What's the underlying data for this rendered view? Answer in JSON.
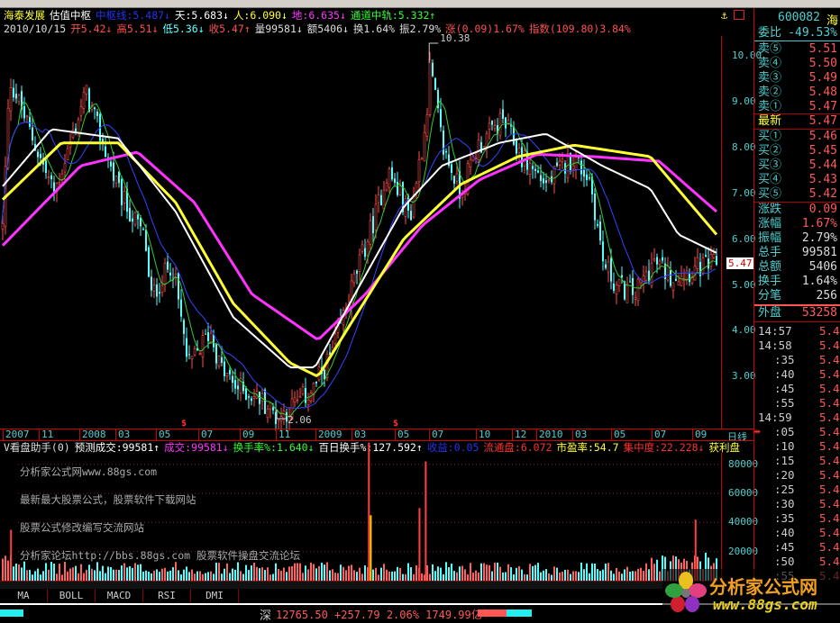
{
  "header": {
    "line1": [
      {
        "text": "海泰发展",
        "color": "#ffff33"
      },
      {
        "text": "估值中枢",
        "color": "#ffffff"
      },
      {
        "text": "中枢线:5.487↓",
        "color": "#2233ee"
      },
      {
        "text": "天:5.683↓",
        "color": "#ffffff"
      },
      {
        "text": "人:6.090↓",
        "color": "#ffff33"
      },
      {
        "text": "地:6.635↓",
        "color": "#ff33ff"
      },
      {
        "text": "通道中轨:5.332↑",
        "color": "#33ff33"
      }
    ],
    "line2": [
      {
        "text": "2010/10/15",
        "color": "#dddddd"
      },
      {
        "text": "开5.42↓",
        "color": "#ff5050"
      },
      {
        "text": "高5.51↓",
        "color": "#ff5050"
      },
      {
        "text": "低5.36↓",
        "color": "#66ffff"
      },
      {
        "text": "收5.47↑",
        "color": "#ff5050"
      },
      {
        "text": "量99581↓",
        "color": "#dddddd"
      },
      {
        "text": "额5406↓",
        "color": "#dddddd"
      },
      {
        "text": "换1.64%",
        "color": "#dddddd"
      },
      {
        "text": "振2.79%",
        "color": "#dddddd"
      },
      {
        "text": "涨(0.09)1.67%",
        "color": "#ff5050"
      },
      {
        "text": "指数(109.80)3.84%",
        "color": "#ff5050"
      }
    ]
  },
  "volume_header": [
    {
      "text": "V看盘助手(0)",
      "color": "#dddddd"
    },
    {
      "text": "预测成交:99581↑",
      "color": "#ffffff"
    },
    {
      "text": "成交:99581↓",
      "color": "#ff33ff"
    },
    {
      "text": "换手率%:1.640↓",
      "color": "#33ff33"
    },
    {
      "text": "百日换手%:127.592↑",
      "color": "#ffffff"
    },
    {
      "text": "收益:0.05",
      "color": "#2233ee"
    },
    {
      "text": "流通盘:6.072",
      "color": "#ff3030"
    },
    {
      "text": "市盈率:54.7",
      "color": "#ffff33"
    },
    {
      "text": "集中度:22.228↓",
      "color": "#ff3030"
    },
    {
      "text": "获利盘",
      "color": "#ffff33"
    }
  ],
  "watermark_lines": [
    "分析家公式网www.88gs.com",
    "最新最大股票公式，股票软件下载网站",
    "股票公式修改编写交流网站",
    "分析家论坛http://bbs.88gs.com 股票软件操盘交流论坛"
  ],
  "logo": {
    "title": "分析家公式网",
    "url": "www.88gs.com"
  },
  "right_panel": {
    "code": "600082",
    "name": "海",
    "weibi_label": "委比",
    "weibi": "-49.53%",
    "sells": [
      {
        "label": "卖⑤",
        "price": "5.51"
      },
      {
        "label": "卖④",
        "price": "5.50"
      },
      {
        "label": "卖③",
        "price": "5.49"
      },
      {
        "label": "卖②",
        "price": "5.48"
      },
      {
        "label": "卖①",
        "price": "5.47"
      }
    ],
    "latest": {
      "label": "最新",
      "price": "5.47"
    },
    "buys": [
      {
        "label": "买①",
        "price": "5.46"
      },
      {
        "label": "买②",
        "price": "5.45"
      },
      {
        "label": "买③",
        "price": "5.44"
      },
      {
        "label": "买④",
        "price": "5.43"
      },
      {
        "label": "买⑤",
        "price": "5.42"
      }
    ],
    "stats": [
      {
        "label": "涨跌",
        "value": "0.09",
        "color": "#ff5a5a"
      },
      {
        "label": "涨幅",
        "value": "1.67%",
        "color": "#ff5a5a"
      },
      {
        "label": "振幅",
        "value": "2.79%",
        "color": "#dddddd"
      },
      {
        "label": "总手",
        "value": "99581",
        "color": "#dddddd"
      },
      {
        "label": "总额",
        "value": "5406",
        "color": "#dddddd"
      },
      {
        "label": "换手",
        "value": "1.64%",
        "color": "#dddddd"
      },
      {
        "label": "分笔",
        "value": "256",
        "color": "#dddddd"
      }
    ],
    "outer": {
      "label": "外盘",
      "value": "53258"
    },
    "ticks": [
      {
        "t": "14:57",
        "p": "5.4"
      },
      {
        "t": "14:58",
        "p": "5.4"
      },
      {
        "t": ":35",
        "p": "5.4"
      },
      {
        "t": ":40",
        "p": "5.4"
      },
      {
        "t": ":45",
        "p": "5.4"
      },
      {
        "t": ":55",
        "p": "5.4"
      },
      {
        "t": "14:59",
        "p": "5.4"
      },
      {
        "t": ":05",
        "p": "5.4"
      },
      {
        "t": ":10",
        "p": "5.4"
      },
      {
        "t": ":15",
        "p": "5.4"
      },
      {
        "t": ":20",
        "p": "5.4"
      },
      {
        "t": ":25",
        "p": "5.4"
      },
      {
        "t": ":30",
        "p": "5.4"
      },
      {
        "t": ":35",
        "p": "5.4"
      },
      {
        "t": ":40",
        "p": "5.4"
      },
      {
        "t": ":45",
        "p": "5.4"
      },
      {
        "t": ":50",
        "p": "5.4"
      },
      {
        "t": ":55",
        "p": "5.4"
      }
    ]
  },
  "price_axis": [
    "10.00",
    "9.00",
    "8.00",
    "7.00",
    "6.00",
    "5.00",
    "4.00",
    "3.00"
  ],
  "current_price_marker": "5.47",
  "high_label": "10.38",
  "low_label": "2.06",
  "volume_axis": [
    "80000",
    "60000",
    "40000",
    "20000"
  ],
  "date_axis": [
    "2007",
    "11",
    "2008",
    "03",
    "05",
    "07",
    "09",
    "11",
    "2009",
    "03",
    "05",
    "07",
    "10",
    "12",
    "2010",
    "03",
    "05",
    "07",
    "09"
  ],
  "period_label": "日线",
  "tabs": [
    "MA",
    "BOLL",
    "MACD",
    "RSI",
    "DMI"
  ],
  "status": {
    "market": "深",
    "text": "12765.50 +257.79 2.06% 1749.99亿"
  },
  "chart_data": {
    "type": "candlestick",
    "start_date": "2007-09-01",
    "end_date": "2010-10-15",
    "ylim": [
      2.0,
      10.6
    ],
    "approx_close_path": [
      [
        "2007-09-01",
        7.5
      ],
      [
        "2007-09-08",
        9.5
      ],
      [
        "2007-10-20",
        8.0
      ],
      [
        "2007-11-18",
        7.0
      ],
      [
        "2008-01-08",
        9.2
      ],
      [
        "2008-03-01",
        7.0
      ],
      [
        "2008-04-12",
        6.0
      ],
      [
        "2008-04-20",
        4.7
      ],
      [
        "2008-05-25",
        5.5
      ],
      [
        "2008-06-20",
        3.2
      ],
      [
        "2008-07-25",
        4.0
      ],
      [
        "2008-08-10",
        3.2
      ],
      [
        "2008-09-01",
        2.8
      ],
      [
        "2008-10-15",
        2.5
      ],
      [
        "2008-11-10",
        2.1
      ],
      [
        "2009-01-05",
        2.7
      ],
      [
        "2009-02-05",
        3.5
      ],
      [
        "2009-03-10",
        5.0
      ],
      [
        "2009-04-15",
        6.5
      ],
      [
        "2009-05-05",
        7.5
      ],
      [
        "2009-06-10",
        6.5
      ],
      [
        "2009-07-05",
        8.5
      ],
      [
        "2009-07-12",
        9.8
      ],
      [
        "2009-08-01",
        8.0
      ],
      [
        "2009-08-30",
        7.0
      ],
      [
        "2009-09-25",
        8.0
      ],
      [
        "2009-11-05",
        8.6
      ],
      [
        "2009-12-05",
        7.8
      ],
      [
        "2010-01-15",
        7.2
      ],
      [
        "2010-02-25",
        7.8
      ],
      [
        "2010-03-25",
        7.3
      ],
      [
        "2010-04-15",
        5.5
      ],
      [
        "2010-05-05",
        5.0
      ],
      [
        "2010-06-05",
        4.8
      ],
      [
        "2010-07-05",
        5.5
      ],
      [
        "2010-08-01",
        5.2
      ],
      [
        "2010-10-15",
        5.47
      ]
    ],
    "lines": [
      {
        "color": "#ff33ff",
        "points": [
          [
            "2007-09-01",
            5.9
          ],
          [
            "2008-01-01",
            7.6
          ],
          [
            "2008-04-01",
            7.9
          ],
          [
            "2008-07-01",
            6.8
          ],
          [
            "2008-10-01",
            4.8
          ],
          [
            "2009-01-15",
            3.8
          ],
          [
            "2009-04-01",
            4.8
          ],
          [
            "2009-07-01",
            6.3
          ],
          [
            "2009-10-01",
            7.3
          ],
          [
            "2010-01-01",
            7.85
          ],
          [
            "2010-04-01",
            7.8
          ],
          [
            "2010-07-15",
            7.7
          ],
          [
            "2010-10-15",
            6.6
          ]
        ]
      },
      {
        "color": "#ffff33",
        "points": [
          [
            "2007-09-01",
            6.9
          ],
          [
            "2007-12-01",
            8.1
          ],
          [
            "2008-03-01",
            8.1
          ],
          [
            "2008-06-01",
            6.8
          ],
          [
            "2008-09-01",
            4.6
          ],
          [
            "2008-12-01",
            3.3
          ],
          [
            "2009-01-15",
            3.0
          ],
          [
            "2009-03-15",
            4.3
          ],
          [
            "2009-06-01",
            6.0
          ],
          [
            "2009-09-01",
            7.2
          ],
          [
            "2009-12-01",
            7.8
          ],
          [
            "2010-03-01",
            8.05
          ],
          [
            "2010-07-01",
            7.8
          ],
          [
            "2010-10-15",
            6.1
          ]
        ]
      },
      {
        "color": "#ffffff",
        "points": [
          [
            "2007-09-01",
            7.2
          ],
          [
            "2007-11-15",
            8.4
          ],
          [
            "2008-03-01",
            8.2
          ],
          [
            "2008-06-01",
            6.6
          ],
          [
            "2008-09-01",
            4.3
          ],
          [
            "2008-12-01",
            3.2
          ],
          [
            "2009-01-10",
            3.2
          ],
          [
            "2009-03-15",
            4.8
          ],
          [
            "2009-06-01",
            6.7
          ],
          [
            "2009-08-01",
            7.6
          ],
          [
            "2009-11-01",
            8.1
          ],
          [
            "2010-01-15",
            8.3
          ],
          [
            "2010-04-15",
            7.6
          ],
          [
            "2010-07-01",
            7.1
          ],
          [
            "2010-08-15",
            6.1
          ],
          [
            "2010-10-15",
            5.7
          ]
        ]
      }
    ],
    "volume_spikes": [
      [
        "2009-04-05",
        95000
      ],
      [
        "2009-04-08",
        45000
      ],
      [
        "2009-07-05",
        82000
      ],
      [
        "2009-06-25",
        50000
      ],
      [
        "2007-09-10",
        35000
      ],
      [
        "2010-09-10",
        42000
      ]
    ],
    "up_color": "#ff5050",
    "down_color": "#54ffff"
  }
}
